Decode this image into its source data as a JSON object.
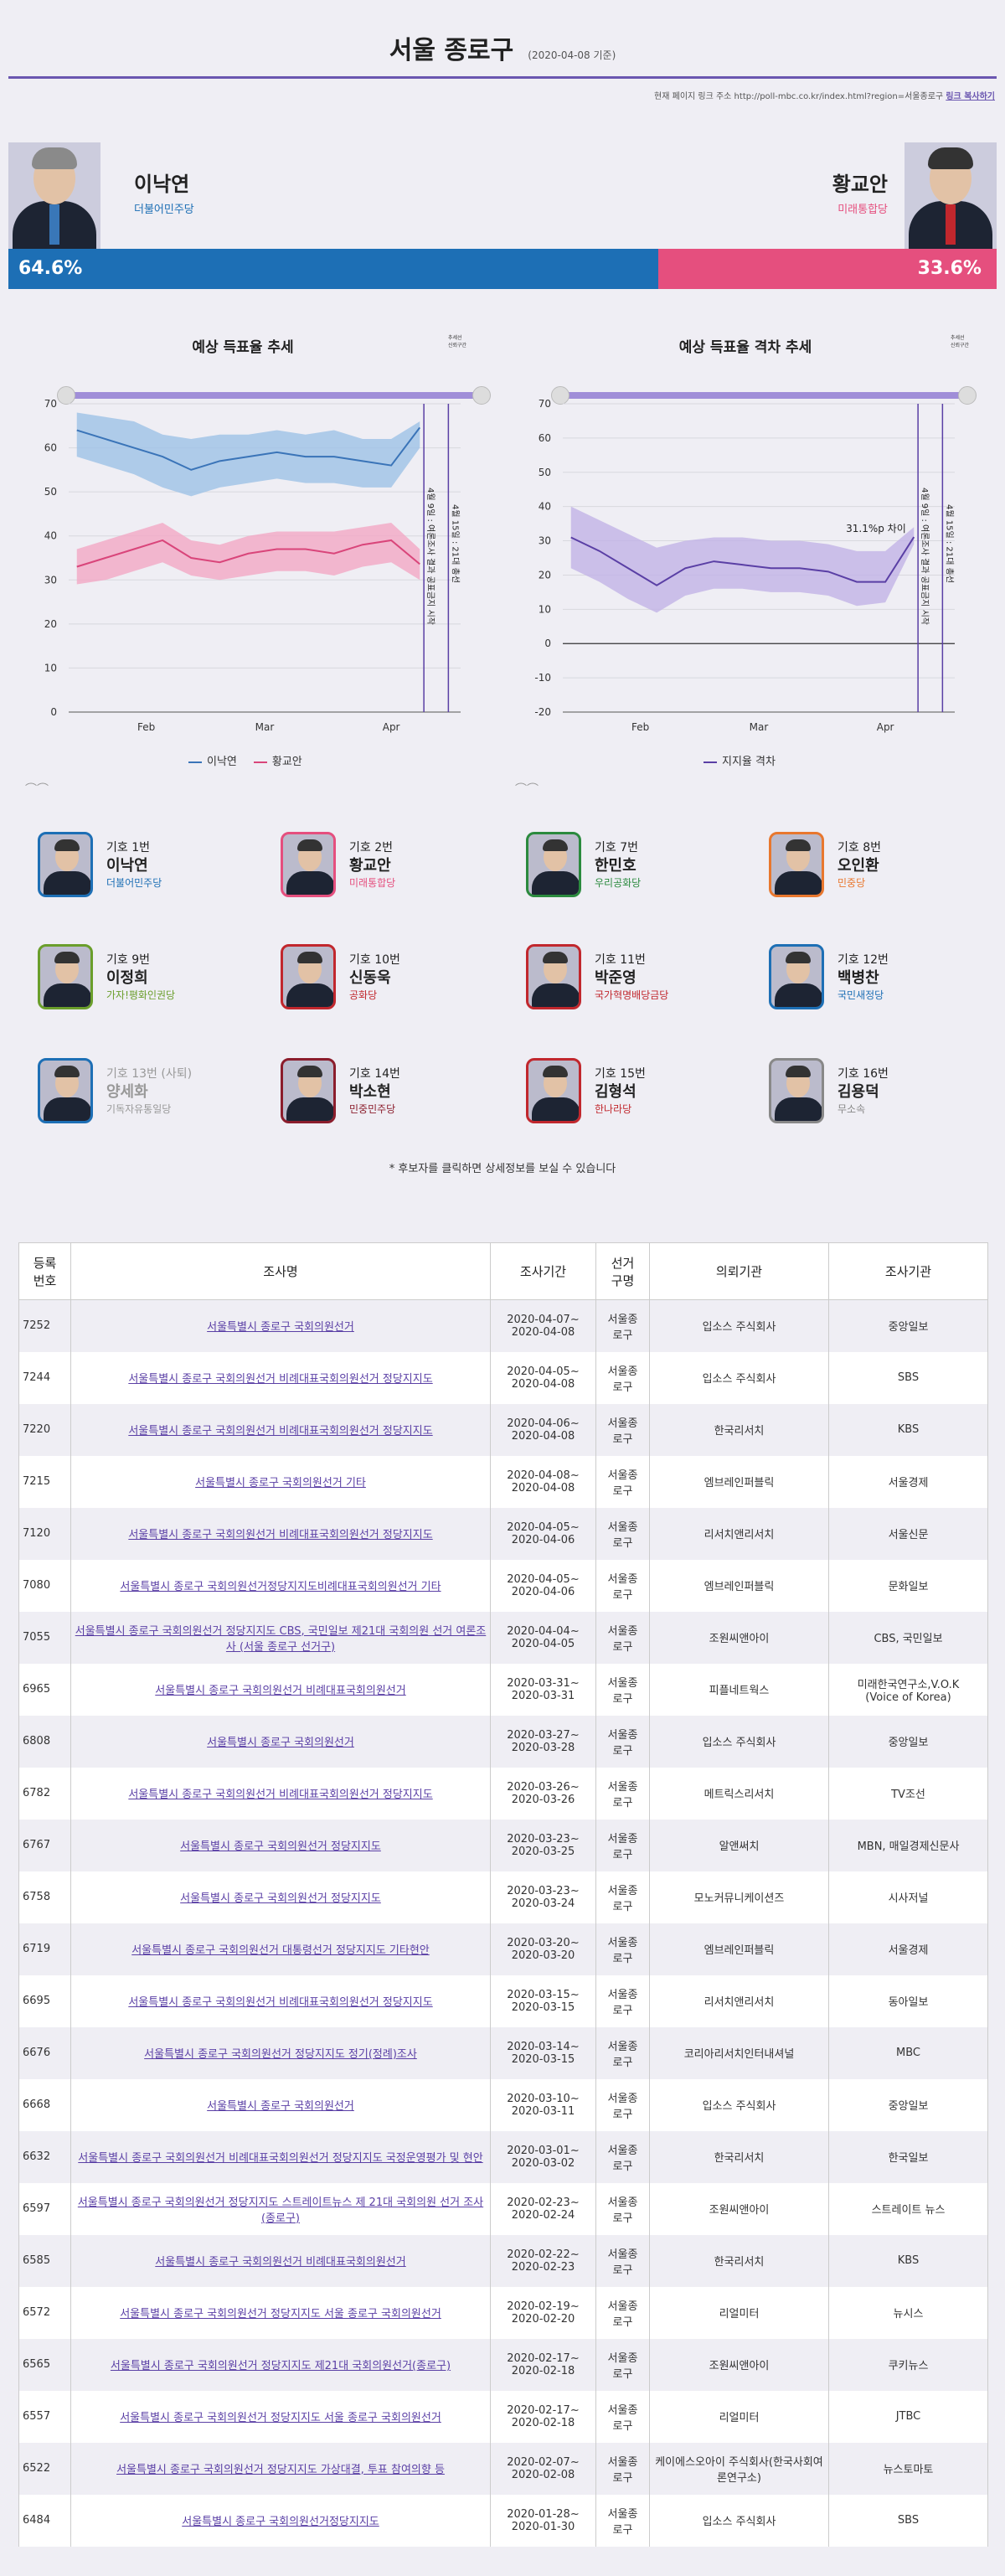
{
  "header": {
    "title": "서울 종로구",
    "date": "(2020-04-08 기준)"
  },
  "link": {
    "prefix": "현재 페이지 링크 주소 http://poll-mbc.co.kr/index.html?region=서울종로구",
    "copy": "링크 복사하기"
  },
  "top": {
    "left": {
      "name": "이낙연",
      "party": "더불어민주당",
      "pct": "64.6%",
      "pct_value": 64.6,
      "color": "#1d6fb5"
    },
    "right": {
      "name": "황교안",
      "party": "미래통합당",
      "pct": "33.6%",
      "pct_value": 33.6,
      "color": "#e54f7e"
    }
  },
  "charts": {
    "minilegend": [
      "추세선",
      "신뢰구간"
    ],
    "vline1": "4월 9일 : 여론조사 결과 공표금지 시작",
    "vline2": "4월 15일 : 21대 총선"
  },
  "chart_data": [
    {
      "type": "line",
      "title": "예상 득표율 추세",
      "ylim": [
        0,
        70
      ],
      "yticks": [
        0,
        10,
        20,
        30,
        40,
        50,
        60,
        70
      ],
      "xticks": [
        "Feb",
        "Mar",
        "Apr"
      ],
      "x": [
        "2020-01-15",
        "2020-01-22",
        "2020-01-29",
        "2020-02-05",
        "2020-02-12",
        "2020-02-19",
        "2020-02-26",
        "2020-03-04",
        "2020-03-11",
        "2020-03-18",
        "2020-03-25",
        "2020-04-01",
        "2020-04-08"
      ],
      "series": [
        {
          "name": "이낙연",
          "color": "#3a74b8",
          "band": "#9ec2e6",
          "values": [
            64,
            62,
            60,
            58,
            55,
            57,
            58,
            59,
            58,
            58,
            57,
            56,
            64.6
          ],
          "lower": [
            58,
            56,
            54,
            51,
            49,
            51,
            52,
            53,
            52,
            52,
            51,
            51,
            60
          ],
          "upper": [
            68,
            67,
            66,
            63,
            62,
            63,
            63,
            64,
            63,
            64,
            62,
            62,
            66
          ]
        },
        {
          "name": "황교안",
          "color": "#d9457a",
          "band": "#f2a7c4",
          "values": [
            33,
            35,
            37,
            39,
            35,
            34,
            36,
            37,
            37,
            36,
            38,
            39,
            33.6
          ],
          "lower": [
            29,
            30,
            32,
            34,
            31,
            30,
            31,
            32,
            32,
            31,
            33,
            34,
            30
          ],
          "upper": [
            37,
            39,
            41,
            43,
            39,
            38,
            40,
            41,
            41,
            41,
            42,
            43,
            37
          ]
        }
      ]
    },
    {
      "type": "line",
      "title": "예상 득표율 격차 추세",
      "ylim": [
        -20,
        70
      ],
      "yticks": [
        -20,
        -10,
        0,
        10,
        20,
        30,
        40,
        50,
        60,
        70
      ],
      "xticks": [
        "Feb",
        "Mar",
        "Apr"
      ],
      "x": [
        "2020-01-15",
        "2020-01-22",
        "2020-01-29",
        "2020-02-05",
        "2020-02-12",
        "2020-02-19",
        "2020-02-26",
        "2020-03-04",
        "2020-03-11",
        "2020-03-18",
        "2020-03-25",
        "2020-04-01",
        "2020-04-08"
      ],
      "annotation": "31.1%p 차이",
      "series": [
        {
          "name": "지지율 격차",
          "color": "#5a3fa5",
          "band": "#c2b3e6",
          "values": [
            31,
            27,
            22,
            17,
            22,
            24,
            23,
            22,
            22,
            21,
            18,
            18,
            31.1
          ],
          "lower": [
            22,
            18,
            13,
            9,
            14,
            16,
            16,
            15,
            15,
            14,
            11,
            12,
            29
          ],
          "upper": [
            40,
            36,
            32,
            28,
            30,
            31,
            31,
            30,
            30,
            29,
            27,
            27,
            34
          ]
        }
      ]
    }
  ],
  "candidates": [
    {
      "num": "기호 1번",
      "name": "이낙연",
      "party": "더불어민주당",
      "color": "#1d6fb5"
    },
    {
      "num": "기호 2번",
      "name": "황교안",
      "party": "미래통합당",
      "color": "#e54f7e"
    },
    {
      "num": "기호 7번",
      "name": "한민호",
      "party": "우리공화당",
      "color": "#2b8a3e"
    },
    {
      "num": "기호 8번",
      "name": "오인환",
      "party": "민중당",
      "color": "#e8772e"
    },
    {
      "num": "기호 9번",
      "name": "이정희",
      "party": "가자!평화인권당",
      "color": "#6a9e2b"
    },
    {
      "num": "기호 10번",
      "name": "신동욱",
      "party": "공화당",
      "color": "#c1272d"
    },
    {
      "num": "기호 11번",
      "name": "박준영",
      "party": "국가혁명배당금당",
      "color": "#c1272d"
    },
    {
      "num": "기호 12번",
      "name": "백병찬",
      "party": "국민새정당",
      "color": "#1d6fb5"
    },
    {
      "num": "기호 13번 (사퇴)",
      "name": "양세화",
      "party": "기독자유통일당",
      "color": "#1d6fb5"
    },
    {
      "num": "기호 14번",
      "name": "박소현",
      "party": "민중민주당",
      "color": "#8b1d2c"
    },
    {
      "num": "기호 15번",
      "name": "김형석",
      "party": "한나라당",
      "color": "#c1272d"
    },
    {
      "num": "기호 16번",
      "name": "김용덕",
      "party": "무소속",
      "color": "#888888"
    }
  ],
  "note": "* 후보자를 클릭하면 상세정보를 보실 수 있습니다",
  "table": {
    "headers": [
      "등록\n번호",
      "조사명",
      "조사기간",
      "선거\n구명",
      "의뢰기관",
      "조사기관"
    ],
    "rows": [
      [
        "7252",
        "서울특별시 종로구 국회의원선거",
        "2020-04-07~\n2020-04-08",
        "서울종\n로구",
        "입소스 주식회사",
        "중앙일보"
      ],
      [
        "7244",
        "서울특별시 종로구 국회의원선거 비례대표국회의원선거 정당지지도",
        "2020-04-05~\n2020-04-08",
        "서울종\n로구",
        "입소스 주식회사",
        "SBS"
      ],
      [
        "7220",
        "서울특별시 종로구 국회의원선거 비례대표국회의원선거 정당지지도",
        "2020-04-06~\n2020-04-08",
        "서울종\n로구",
        "한국리서치",
        "KBS"
      ],
      [
        "7215",
        "서울특별시 종로구 국회의원선거 기타",
        "2020-04-08~\n2020-04-08",
        "서울종\n로구",
        "엠브레인퍼블릭",
        "서울경제"
      ],
      [
        "7120",
        "서울특별시 종로구 국회의원선거 비례대표국회의원선거 정당지지도",
        "2020-04-05~\n2020-04-06",
        "서울종\n로구",
        "리서치앤리서치",
        "서울신문"
      ],
      [
        "7080",
        "서울특별시 종로구 국회의원선거정당지지도비례대표국회의원선거 기타",
        "2020-04-05~\n2020-04-06",
        "서울종\n로구",
        "엠브레인퍼블릭",
        "문화일보"
      ],
      [
        "7055",
        "서울특별시 종로구 국회의원선거 정당지지도 CBS, 국민일보 제21대 국회의원 선거 여론조사 (서울 종로구 선거구)",
        "2020-04-04~\n2020-04-05",
        "서울종\n로구",
        "조원씨앤아이",
        "CBS, 국민일보"
      ],
      [
        "6965",
        "서울특별시 종로구 국회의원선거 비례대표국회의원선거",
        "2020-03-31~\n2020-03-31",
        "서울종\n로구",
        "피플네트웍스",
        "미래한국연구소,V.O.K\n(Voice of Korea)"
      ],
      [
        "6808",
        "서울특별시 종로구 국회의원선거",
        "2020-03-27~\n2020-03-28",
        "서울종\n로구",
        "입소스 주식회사",
        "중앙일보"
      ],
      [
        "6782",
        "서울특별시 종로구 국회의원선거 비례대표국회의원선거 정당지지도",
        "2020-03-26~\n2020-03-26",
        "서울종\n로구",
        "메트릭스리서치",
        "TV조선"
      ],
      [
        "6767",
        "서울특별시 종로구 국회의원선거 정당지지도",
        "2020-03-23~\n2020-03-25",
        "서울종\n로구",
        "알앤써치",
        "MBN, 매일경제신문사"
      ],
      [
        "6758",
        "서울특별시 종로구 국회의원선거 정당지지도",
        "2020-03-23~\n2020-03-24",
        "서울종\n로구",
        "모노커뮤니케이션즈",
        "시사저널"
      ],
      [
        "6719",
        "서울특별시 종로구 국회의원선거 대통령선거 정당지지도 기타현안",
        "2020-03-20~\n2020-03-20",
        "서울종\n로구",
        "엠브레인퍼블릭",
        "서울경제"
      ],
      [
        "6695",
        "서울특별시 종로구 국회의원선거 비례대표국회의원선거 정당지지도",
        "2020-03-15~\n2020-03-15",
        "서울종\n로구",
        "리서치앤리서치",
        "동아일보"
      ],
      [
        "6676",
        "서울특별시 종로구 국회의원선거 정당지지도 정기(정례)조사",
        "2020-03-14~\n2020-03-15",
        "서울종\n로구",
        "코리아리서치인터내셔널",
        "MBC"
      ],
      [
        "6668",
        "서울특별시 종로구 국회의원선거",
        "2020-03-10~\n2020-03-11",
        "서울종\n로구",
        "입소스 주식회사",
        "중앙일보"
      ],
      [
        "6632",
        "서울특별시 종로구 국회의원선거 비례대표국회의원선거 정당지지도 국정운영평가 및 현안",
        "2020-03-01~\n2020-03-02",
        "서울종\n로구",
        "한국리서치",
        "한국일보"
      ],
      [
        "6597",
        "서울특별시 종로구 국회의원선거 정당지지도 스트레이트뉴스 제 21대 국회의원 선거 조사(종로구)",
        "2020-02-23~\n2020-02-24",
        "서울종\n로구",
        "조원씨앤아이",
        "스트레이트 뉴스"
      ],
      [
        "6585",
        "서울특별시 종로구 국회의원선거 비례대표국회의원선거",
        "2020-02-22~\n2020-02-23",
        "서울종\n로구",
        "한국리서치",
        "KBS"
      ],
      [
        "6572",
        "서울특별시 종로구 국회의원선거 정당지지도 서울 종로구 국회의원선거",
        "2020-02-19~\n2020-02-20",
        "서울종\n로구",
        "리얼미터",
        "뉴시스"
      ],
      [
        "6565",
        "서울특별시 종로구 국회의원선거 정당지지도 제21대 국회의원선거(종로구)",
        "2020-02-17~\n2020-02-18",
        "서울종\n로구",
        "조원씨앤아이",
        "쿠키뉴스"
      ],
      [
        "6557",
        "서울특별시 종로구 국회의원선거 정당지지도 서울 종로구 국회의원선거",
        "2020-02-17~\n2020-02-18",
        "서울종\n로구",
        "리얼미터",
        "JTBC"
      ],
      [
        "6522",
        "서울특별시 종로구 국회의원선거 정당지지도 가상대결, 투표 참여의향 등",
        "2020-02-07~\n2020-02-08",
        "서울종\n로구",
        "케이에스오아이 주식회사(한국사회여론연구소)",
        "뉴스토마토"
      ],
      [
        "6484",
        "서울특별시 종로구 국회의원선거정당지지도",
        "2020-01-28~\n2020-01-30",
        "서울종\n로구",
        "입소스 주식회사",
        "SBS"
      ]
    ]
  }
}
